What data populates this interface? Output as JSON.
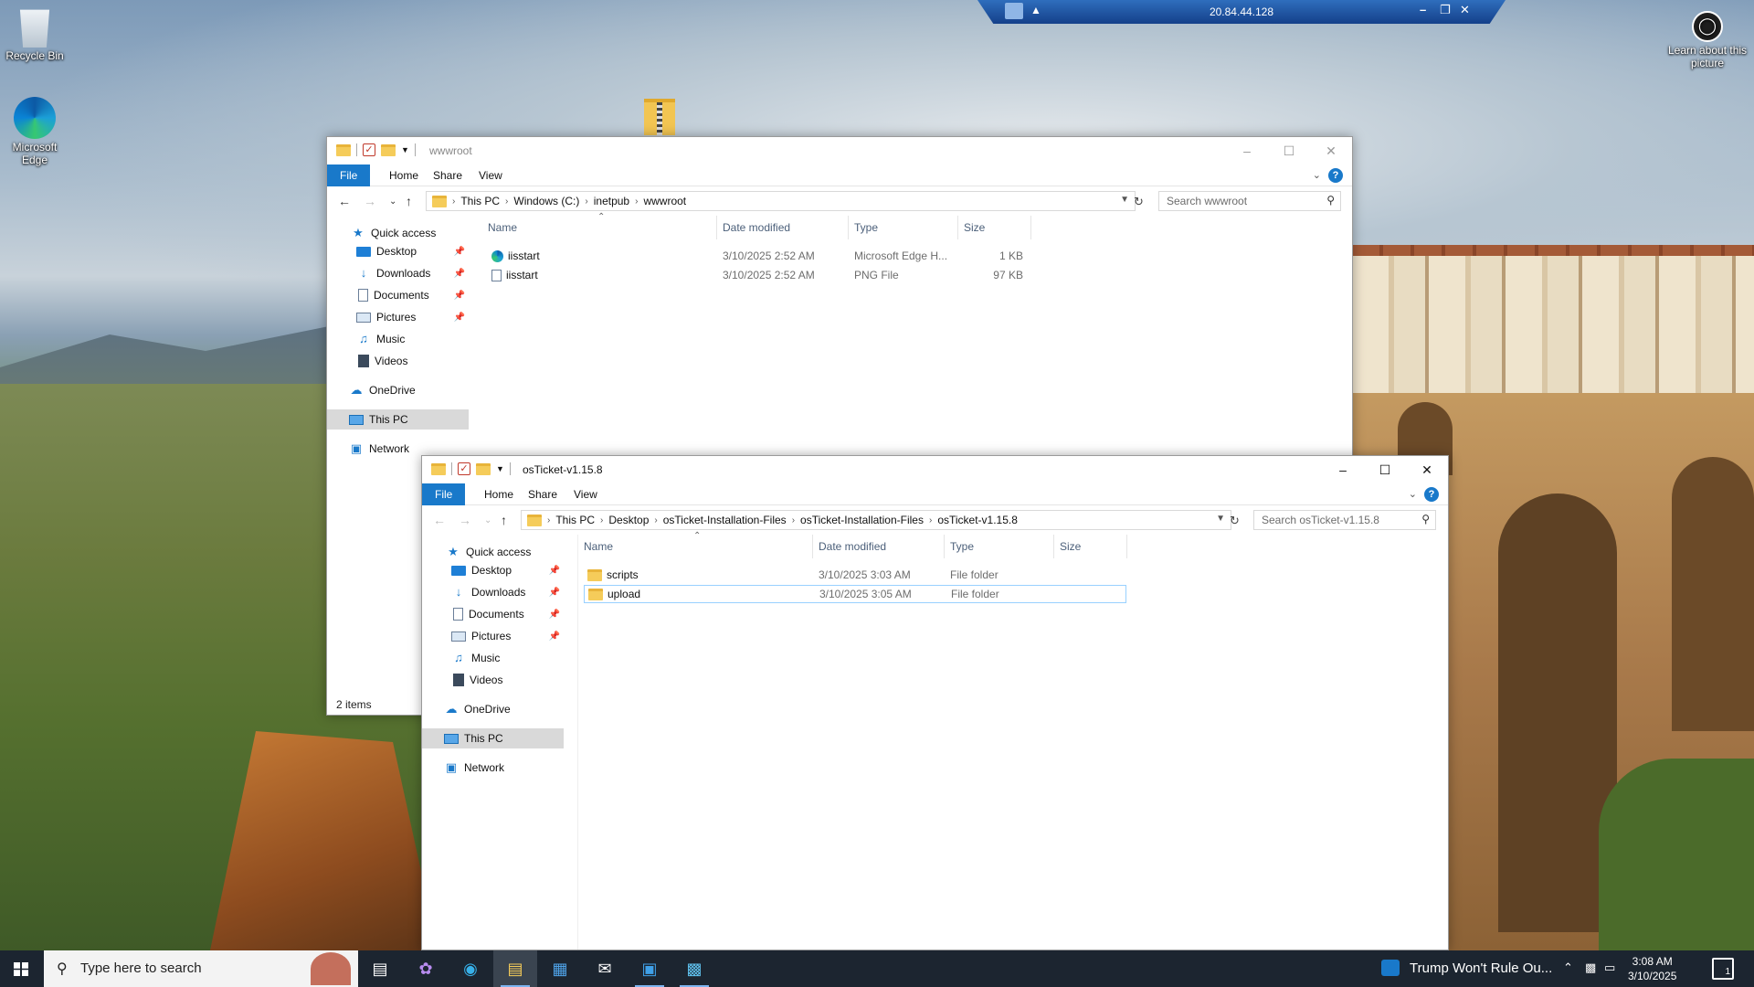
{
  "desktop": {
    "icons": [
      {
        "label": "Recycle Bin",
        "icon": "recycle-bin-icon"
      },
      {
        "label": "Microsoft Edge",
        "icon": "edge-icon"
      }
    ],
    "learn_label": "Learn about this picture"
  },
  "rdp": {
    "ip": "20.84.44.128"
  },
  "window_wwwroot": {
    "title": "wwwroot",
    "tabs": [
      "File",
      "Home",
      "Share",
      "View"
    ],
    "path": [
      "This PC",
      "Windows (C:)",
      "inetpub",
      "wwwroot"
    ],
    "search_placeholder": "Search wwwroot",
    "columns": [
      "Name",
      "Date modified",
      "Type",
      "Size"
    ],
    "files": [
      {
        "name": "iisstart",
        "date": "3/10/2025 2:52 AM",
        "type": "Microsoft Edge H...",
        "size": "1 KB",
        "icon": "edge-html-icon"
      },
      {
        "name": "iisstart",
        "date": "3/10/2025 2:52 AM",
        "type": "PNG File",
        "size": "97 KB",
        "icon": "png-file-icon"
      }
    ],
    "nav": {
      "quick_access": "Quick access",
      "items": [
        "Desktop",
        "Downloads",
        "Documents",
        "Pictures",
        "Music",
        "Videos"
      ],
      "onedrive": "OneDrive",
      "thispc": "This PC",
      "network": "Network"
    },
    "status": "2 items"
  },
  "window_osticket": {
    "title": "osTicket-v1.15.8",
    "tabs": [
      "File",
      "Home",
      "Share",
      "View"
    ],
    "path": [
      "This PC",
      "Desktop",
      "osTicket-Installation-Files",
      "osTicket-Installation-Files",
      "osTicket-v1.15.8"
    ],
    "search_placeholder": "Search osTicket-v1.15.8",
    "columns": [
      "Name",
      "Date modified",
      "Type",
      "Size"
    ],
    "files": [
      {
        "name": "scripts",
        "date": "3/10/2025 3:03 AM",
        "type": "File folder",
        "size": ""
      },
      {
        "name": "upload",
        "date": "3/10/2025 3:05 AM",
        "type": "File folder",
        "size": ""
      }
    ],
    "nav": {
      "quick_access": "Quick access",
      "items": [
        "Desktop",
        "Downloads",
        "Documents",
        "Pictures",
        "Music",
        "Videos"
      ],
      "onedrive": "OneDrive",
      "thispc": "This PC",
      "network": "Network"
    }
  },
  "taskbar": {
    "search_placeholder": "Type here to search",
    "news": "Trump Won't Rule Ou...",
    "time": "3:08 AM",
    "date": "3/10/2025",
    "notifications": "1"
  }
}
